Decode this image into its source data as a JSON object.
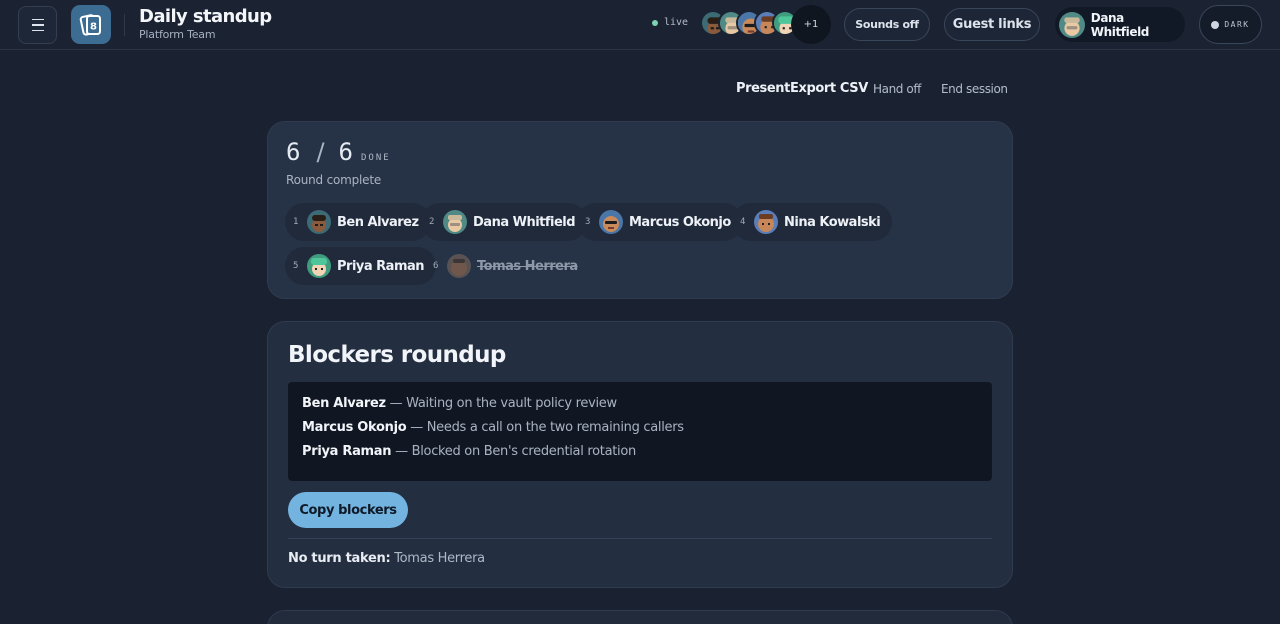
{
  "header": {
    "title": "Daily standup",
    "subtitle": "Platform Team",
    "live_label": "live",
    "presence_more": "+1",
    "sounds_label": "Sounds off",
    "guest_links_label": "Guest links",
    "user_name": "Dana Whitfield",
    "theme_label": "DARK"
  },
  "actions": {
    "present": "Present",
    "export_csv": "Export CSV",
    "hand_off": "Hand off",
    "end_session": "End session"
  },
  "round": {
    "done_count": "6",
    "total_count": "6",
    "done_label": "DONE",
    "status": "Round complete",
    "participants": [
      {
        "index": "1",
        "name": "Ben Alvarez",
        "skipped": false
      },
      {
        "index": "2",
        "name": "Dana Whitfield",
        "skipped": false
      },
      {
        "index": "3",
        "name": "Marcus Okonjo",
        "skipped": false
      },
      {
        "index": "4",
        "name": "Nina Kowalski",
        "skipped": false
      },
      {
        "index": "5",
        "name": "Priya Raman",
        "skipped": false
      },
      {
        "index": "6",
        "name": "Tomas Herrera",
        "skipped": true
      }
    ]
  },
  "blockers": {
    "title": "Blockers roundup",
    "items": [
      {
        "name": "Ben Alvarez",
        "text": "— Waiting on the vault policy review"
      },
      {
        "name": "Marcus Okonjo",
        "text": "— Needs a call on the two remaining callers"
      },
      {
        "name": "Priya Raman",
        "text": "— Blocked on Ben's credential rotation"
      }
    ],
    "copy_label": "Copy blockers",
    "no_turn_label": "No turn taken:",
    "no_turn_names": "Tomas Herrera"
  },
  "colors": {
    "background": "#1a2231",
    "card": "#232e40",
    "accent": "#73b3e0",
    "live": "#7ed3b2"
  }
}
